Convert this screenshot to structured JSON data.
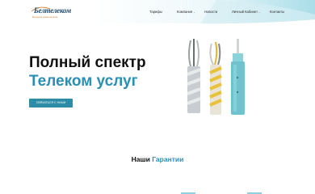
{
  "header": {
    "logo_name": "Белтелеком",
    "logo_tag": "Мы всегда с вами на связи",
    "nav": [
      {
        "label": "Тарифы",
        "caret": ""
      },
      {
        "label": "Компания",
        "caret": "⌄"
      },
      {
        "label": "Новости",
        "caret": ""
      },
      {
        "label": "Личный Кабинет",
        "caret": "⌄"
      },
      {
        "label": "Контакты",
        "caret": ""
      }
    ]
  },
  "hero": {
    "title_line1": "Полный спектр",
    "title_line2": "Телеком услуг",
    "cta_label": "СВЯЗАТЬСЯ С НАМИ"
  },
  "guarantees": {
    "title_a": "Наши",
    "title_b": "Гарантии"
  },
  "colors": {
    "accent": "#2a8fb5",
    "button": "#2e8ca6",
    "nav_gradient": "#bfe6ee",
    "brand_orange": "#d9781f"
  }
}
